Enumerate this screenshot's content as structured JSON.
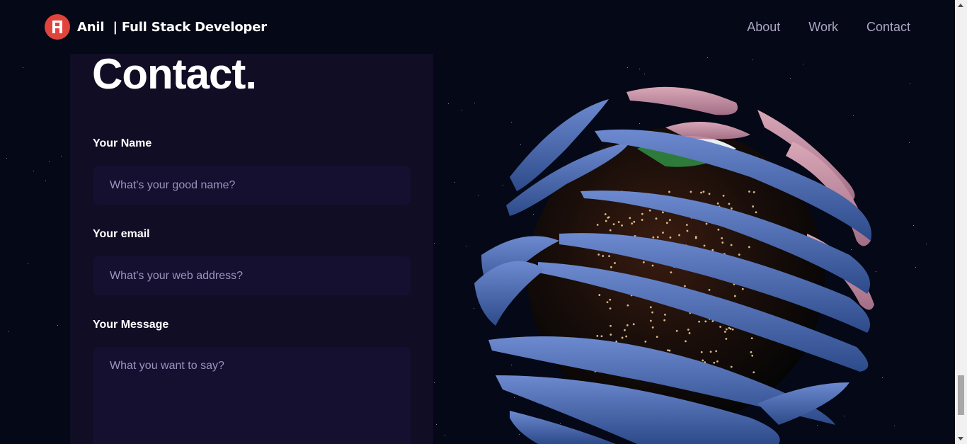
{
  "navbar": {
    "brand_name": "Anil",
    "brand_tagline": "| Full Stack Developer",
    "logo_icon": "logo-icon",
    "links": [
      {
        "label": "About"
      },
      {
        "label": "Work"
      },
      {
        "label": "Contact"
      }
    ]
  },
  "contact": {
    "title": "Contact.",
    "name_label": "Your Name",
    "name_placeholder": "What's your good name?",
    "email_label": "Your email",
    "email_placeholder": "What's your web address?",
    "message_label": "Your Message",
    "message_placeholder": "What you want to say?"
  },
  "colors": {
    "background": "#050816",
    "card": "#100d25",
    "input": "#151030",
    "secondary_text": "#aaa6c3",
    "logo": "#e0443c"
  }
}
